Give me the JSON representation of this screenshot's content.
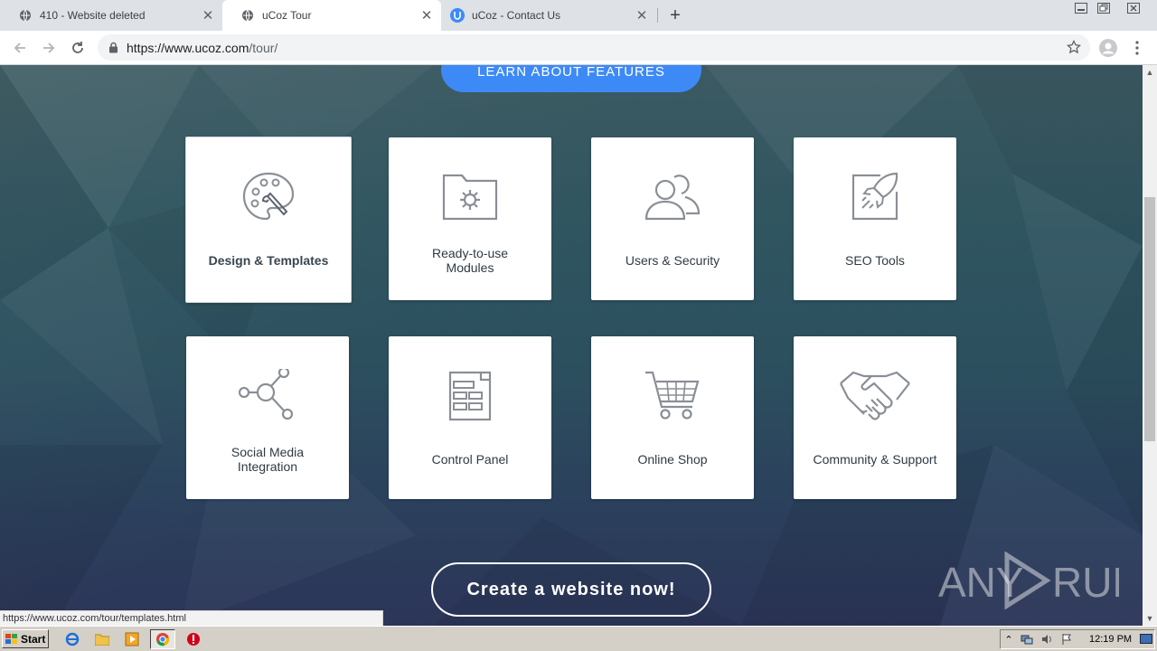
{
  "browser": {
    "tabs": [
      {
        "title": "410 - Website deleted",
        "active": false
      },
      {
        "title": "uCoz Tour",
        "active": true
      },
      {
        "title": "uCoz - Contact Us",
        "active": false
      }
    ],
    "new_tab_symbol": "+",
    "close_symbol": "✕",
    "url_host": "https://www.ucoz.com",
    "url_path": "/tour/"
  },
  "page": {
    "top_button": "LEARN ABOUT FEATURES",
    "features": [
      {
        "label": "Design & Templates",
        "icon": "palette-icon"
      },
      {
        "label": "Ready-to-use Modules",
        "icon": "folder-gear-icon"
      },
      {
        "label": "Users & Security",
        "icon": "users-icon"
      },
      {
        "label": "SEO Tools",
        "icon": "rocket-icon"
      },
      {
        "label": "Social Media Integration",
        "icon": "share-nodes-icon"
      },
      {
        "label": "Control Panel",
        "icon": "control-panel-icon"
      },
      {
        "label": "Online Shop",
        "icon": "cart-icon"
      },
      {
        "label": "Community & Support",
        "icon": "handshake-icon"
      }
    ],
    "cta": "Create a website now!",
    "status_url": "https://www.ucoz.com/tour/templates.html",
    "watermark_any": "ANY",
    "watermark_run": "RUN"
  },
  "taskbar": {
    "start": "Start",
    "clock": "12:19 PM"
  },
  "colors": {
    "accent_blue": "#3d8af7",
    "card_bg": "#ffffff",
    "icon_stroke": "#8a8f96"
  }
}
